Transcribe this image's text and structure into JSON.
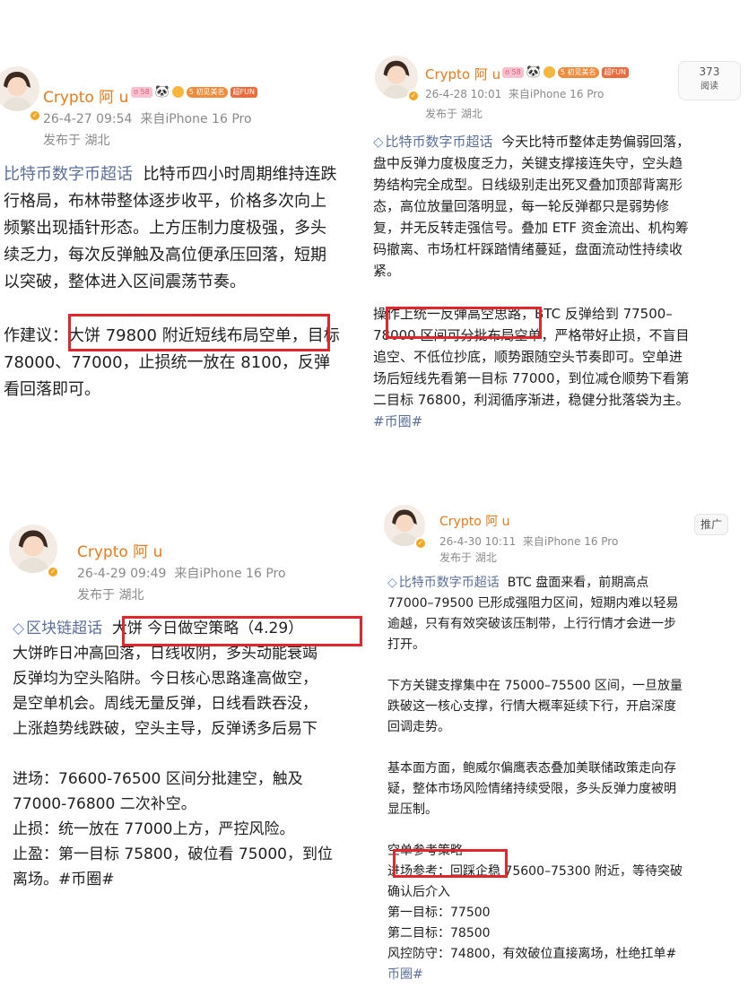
{
  "user": {
    "name": "Crypto 阿 u",
    "badges": {
      "level": "5",
      "meet": "初见美名",
      "fun": "超FUN",
      "panda": "🐼"
    }
  },
  "posts": [
    {
      "time": "26-4-27 09:54",
      "device": "来自iPhone 16 Pro",
      "location": "发布于 湖北",
      "topic": "比特币数字币超话",
      "lines": [
        "比特币四小时周期维持连跌",
        "行格局，布林带整体逐步收平，价格多次向上",
        "频繁出现插针形态。上方压制力度极强，多头",
        "续乏力，每次反弹触及高位便承压回落，短期",
        "以突破，整体进入区间震荡节奏。",
        "",
        "作建议：大饼 79800 附近短线布局空单，目标",
        "78000、77000，止损统一放在 8100，反弹",
        "看回落即可。"
      ]
    },
    {
      "time": "26-4-28 10:01",
      "device": "来自iPhone 16 Pro",
      "location": "发布于 湖北",
      "views": "373",
      "views_label": "阅读",
      "topic": "比特币数字币超话",
      "lines": [
        "今天比特币整体走势偏弱回落，",
        "盘中反弹力度极度乏力，关键支撑接连失守，空头趋",
        "势结构完全成型。日线级别走出死叉叠加顶部背离形",
        "态，高位放量回落明显，每一轮反弹都只是弱势修",
        "复，并无反转走强信号。叠加 ETF 资金流出、机构筹",
        "码撤离、市场杠杆踩踏情绪蔓延，盘面流动性持续收",
        "紧。",
        "",
        "操作上统一反弹高空思路，BTC 反弹给到 77500–",
        "78000 区间可分批布局空单，严格带好止损，不盲目",
        "追空、不低位抄底，顺势跟随空头节奏即可。空单进",
        "场后短线先看第一目标 77000，到位减仓顺势下看第",
        "二目标 76800，利润循序渐进，稳健分批落袋为主。",
        "#币圈#"
      ]
    },
    {
      "time": "26-4-29 09:49",
      "device": "来自iPhone 16 Pro",
      "location": "发布于 湖北",
      "topic": "区块链超话",
      "lines": [
        "大饼 今日做空策略（4.29）",
        "大饼昨日冲高回落，日线收阴，多头动能衰竭",
        "反弹均为空头陷阱。今日核心思路逢高做空，",
        "是空单机会。周线无量反弹，日线看跌吞没，",
        "上涨趋势线跌破，空头主导，反弹诱多后易下",
        "",
        "进场：76600-76500 区间分批建空，触及",
        "77000-76800 二次补空。",
        "止损：统一放在 77000上方，严控风险。",
        "止盈：第一目标 75800，破位看 75000，到位",
        "离场。#币圈#"
      ]
    },
    {
      "time": "26-4-30 10:11",
      "device": "来自iPhone 16 Pro",
      "location": "发布于 湖北",
      "promo": "推广",
      "topic": "比特币数字币超话",
      "lines": [
        "BTC 盘面来看，前期高点",
        "77000–79500 已形成强阻力区间，短期内难以轻易",
        "逾越，只有有效突破该压制带，上行行情才会进一步",
        "打开。",
        "",
        "下方关键支撑集中在 75000–75500 区间，一旦放量",
        "跌破这一核心支撑，行情大概率延续下行，开启深度",
        "回调走势。",
        "",
        "基本面方面，鲍威尔偏鹰表态叠加美联储政策走向存",
        "疑，整体市场风险情绪持续受限，多头反弹力度被明",
        "显压制。",
        "",
        "空单参考策略",
        "进场参考：回踩企稳 75600–75300 附近，等待突破",
        "确认后介入",
        "第一目标：77500",
        "第二目标：78500",
        "风控防守：74800，有效破位直接离场，杜绝扛单#",
        "币圈#"
      ]
    }
  ],
  "colors": {
    "username": "#f07a1a",
    "link": "#5b6f9e",
    "highlight_box": "#e2262c",
    "meta": "#8a8a8a"
  }
}
